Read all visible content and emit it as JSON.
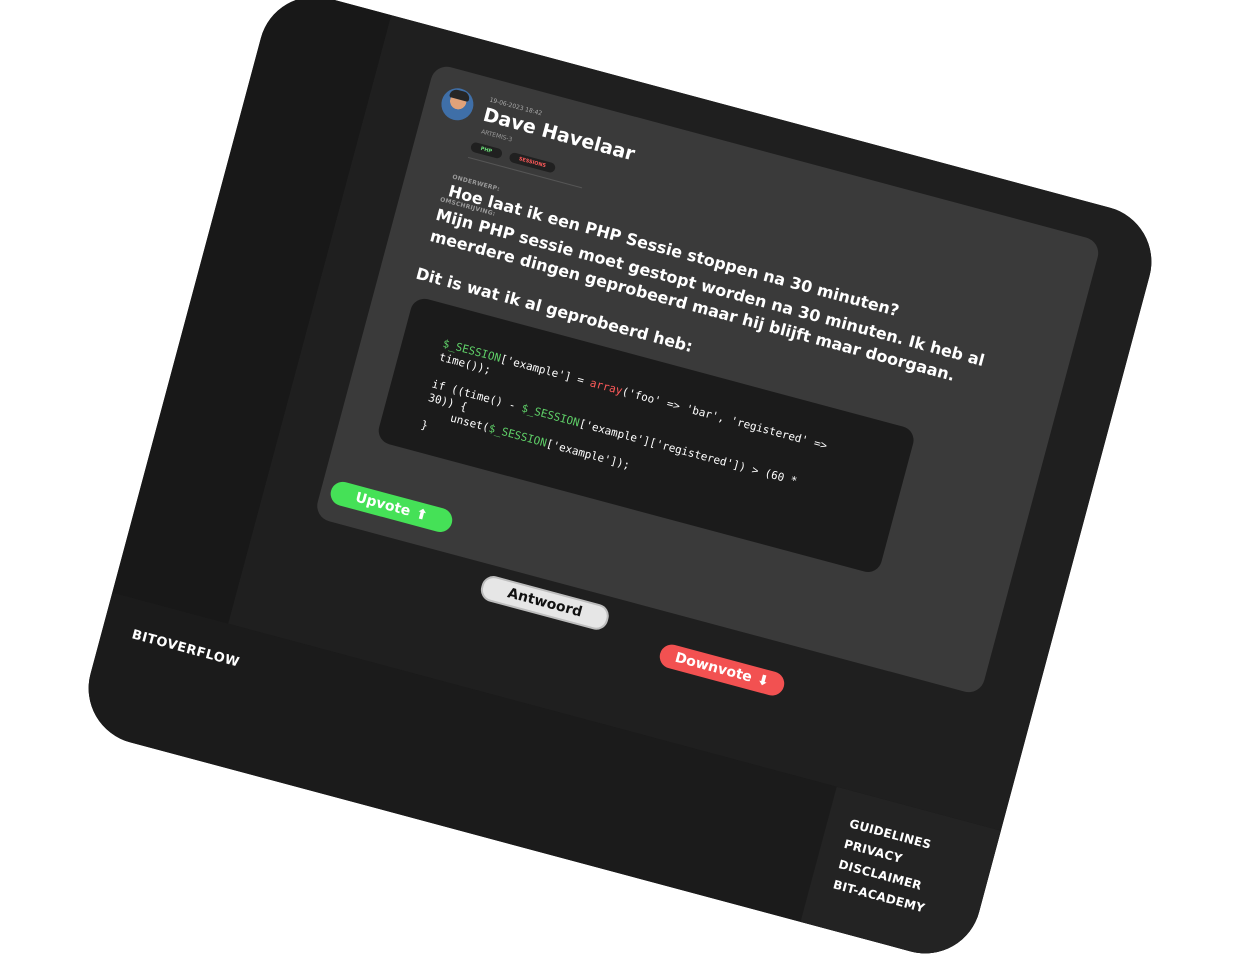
{
  "post": {
    "date": "19-06-2023 18:42",
    "author_name": "Dave Havelaar",
    "author_handle": "ARTEMIS-3",
    "tags": [
      "PHP",
      "SESSIONS"
    ],
    "subject_label": "ONDERWERP:",
    "subject": "Hoe laat ik een PHP Sessie stoppen na 30 minuten?",
    "description_label": "OMSCHRIJVING:",
    "description": "Mijn PHP sessie moet gestopt worden na 30 minuten. Ik heb al meerdere dingen geprobeerd maar hij blijft maar doorgaan.",
    "intro": "Dit is wat ik al geprobeerd heb:"
  },
  "code": {
    "line1_var": "$_SESSION",
    "line1_mid": "['example'] = ",
    "line1_fn": "array",
    "line1_rest": "('foo' => 'bar', 'registered' =>",
    "line2": "time());",
    "line3_pre": "if ((time() - ",
    "line3_var": "$_SESSION",
    "line3_rest": "['example']['registered']) > (60 *",
    "line4": "30)) {",
    "line5_pre": "    unset(",
    "line5_var": "$_SESSION",
    "line5_rest": "['example']);",
    "line6": "}"
  },
  "actions": {
    "upvote_label": "Upvote",
    "upvote_icon": "⬆",
    "answer_label": "Antwoord",
    "downvote_label": "Downvote",
    "downvote_icon": "⬇"
  },
  "footer": {
    "brand": "BITOVERFLOW",
    "links": [
      "GUIDELINES",
      "PRIVACY",
      "DISCLAIMER",
      "BIT-ACADEMY"
    ]
  },
  "colors": {
    "upvote": "#45e157",
    "downvote": "#f25151",
    "answer": "#e6e6e6",
    "card": "#3a3a3a",
    "code_var": "#5fd068",
    "code_fn": "#ff5a5a"
  }
}
